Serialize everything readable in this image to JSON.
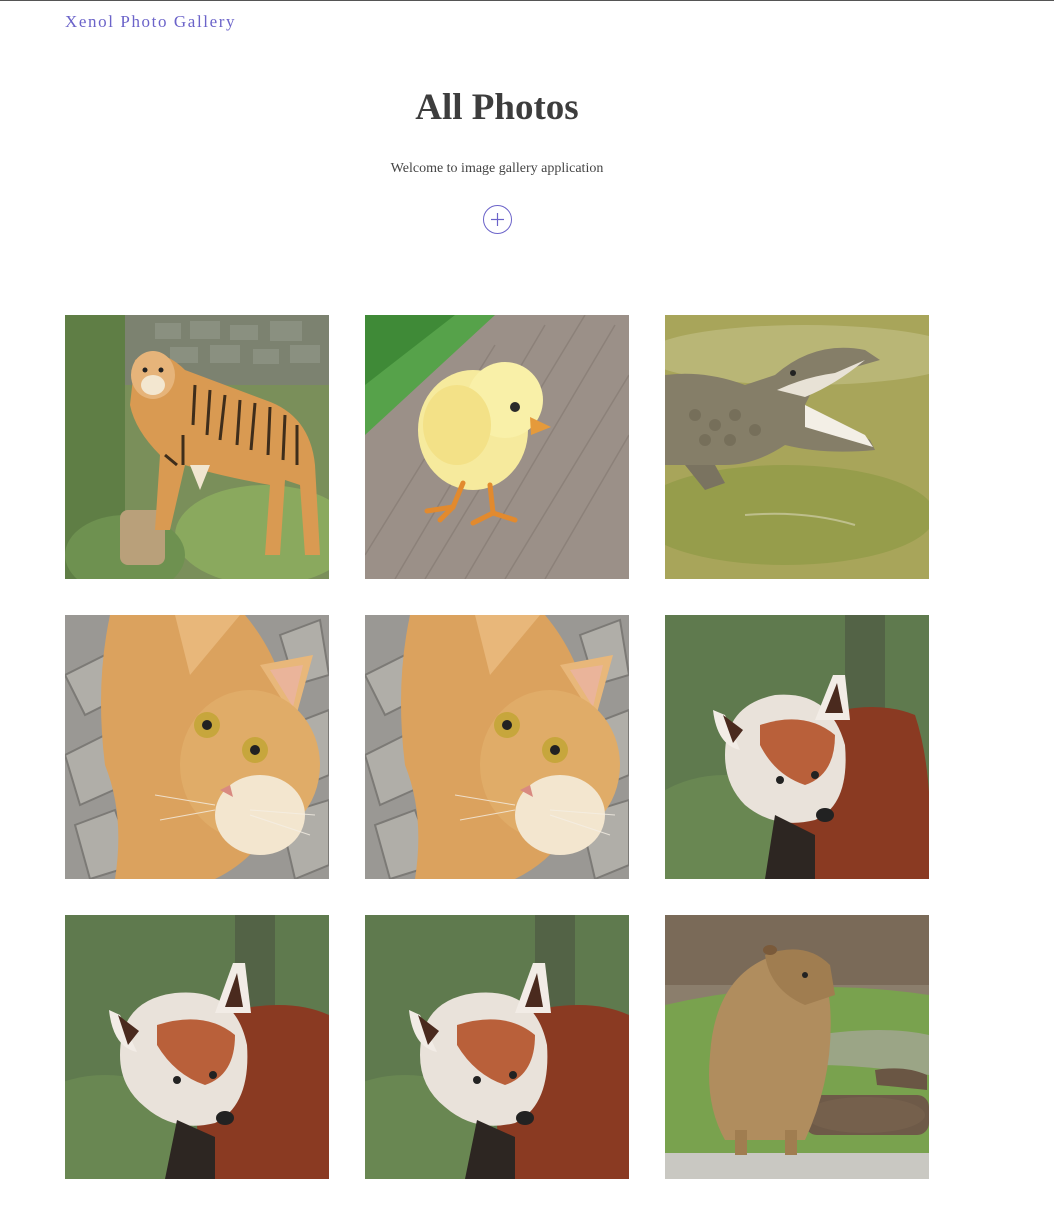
{
  "header": {
    "brand": "Xenol Photo Gallery"
  },
  "hero": {
    "title": "All Photos",
    "subtitle": "Welcome to image gallery application",
    "add_icon": "plus-circle-icon"
  },
  "photos": [
    {
      "subject": "tiger"
    },
    {
      "subject": "chick"
    },
    {
      "subject": "crocodile"
    },
    {
      "subject": "cat"
    },
    {
      "subject": "cat"
    },
    {
      "subject": "red-panda"
    },
    {
      "subject": "red-panda"
    },
    {
      "subject": "red-panda"
    },
    {
      "subject": "capybara"
    }
  ]
}
